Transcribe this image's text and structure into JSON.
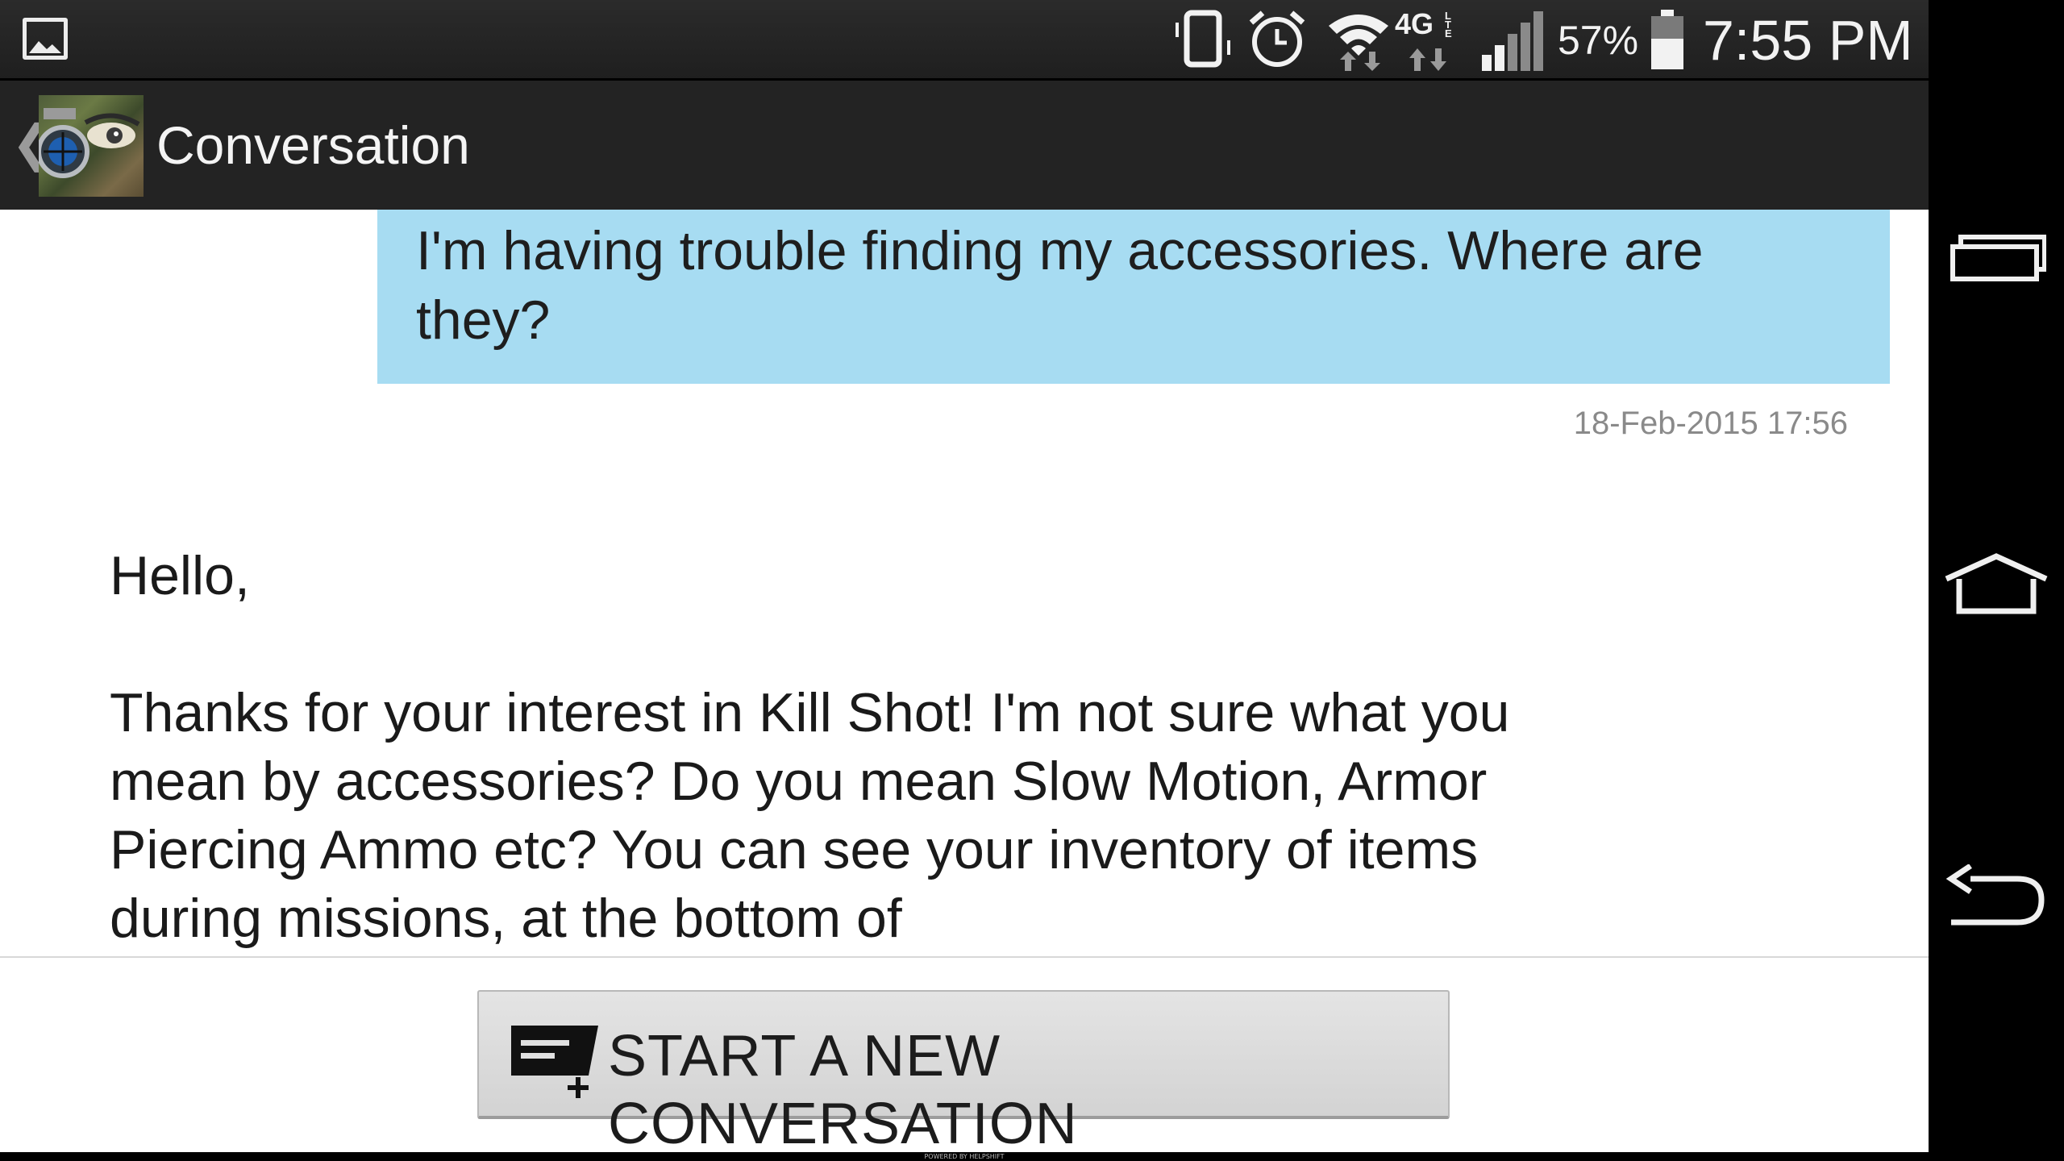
{
  "status_bar": {
    "battery_percent": "57%",
    "time": "7:55 PM",
    "network": "4G LTE",
    "icons": [
      "gallery-icon",
      "vibrate-icon",
      "alarm-icon",
      "wifi-icon",
      "lte-icon",
      "signal-icon",
      "battery-icon"
    ]
  },
  "action_bar": {
    "title": "Conversation",
    "back_icon": "chevron-left-icon",
    "avatar": "kill-shot-app-avatar"
  },
  "conversation": {
    "user_message": {
      "text": "I'm having trouble finding my accessories. Where are they?",
      "timestamp": "18-Feb-2015 17:56",
      "bubble_color": "#a7dcf2"
    },
    "agent_message": {
      "greeting": "Hello,",
      "body": "Thanks for your interest in Kill Shot! I'm not sure what you mean by accessories? Do you mean Slow Motion, Armor Piercing Ammo etc? You can see your inventory of items during missions, at the bottom of"
    }
  },
  "footer": {
    "new_conversation_label": "START A NEW CONVERSATION",
    "new_conversation_icon": "new-conversation-icon",
    "powered_by": "POWERED BY HELPSHIFT"
  },
  "nav_bar": {
    "buttons": [
      "recent-apps-icon",
      "home-icon",
      "back-icon"
    ]
  }
}
